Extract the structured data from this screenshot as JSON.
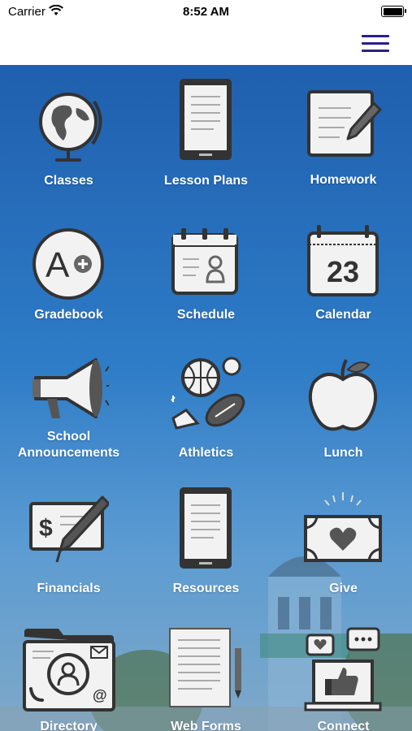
{
  "status_bar": {
    "carrier": "Carrier",
    "time": "8:52 AM"
  },
  "nav": {
    "menu_icon": "hamburger-menu-icon"
  },
  "tiles": [
    {
      "label": "Classes",
      "icon": "globe-icon"
    },
    {
      "label": "Lesson Plans",
      "icon": "tablet-icon"
    },
    {
      "label": "Homework",
      "icon": "notepad-pencil-icon"
    },
    {
      "label": "Gradebook",
      "icon": "grade-a-plus-icon"
    },
    {
      "label": "Schedule",
      "icon": "schedule-icon"
    },
    {
      "label": "Calendar",
      "icon": "calendar-icon",
      "number": "23"
    },
    {
      "label": "School Announcements",
      "icon": "megaphone-icon"
    },
    {
      "label": "Athletics",
      "icon": "sports-balls-icon"
    },
    {
      "label": "Lunch",
      "icon": "apple-icon"
    },
    {
      "label": "Financials",
      "icon": "check-pen-icon"
    },
    {
      "label": "Resources",
      "icon": "tablet-icon"
    },
    {
      "label": "Give",
      "icon": "donation-heart-icon"
    },
    {
      "label": "Directory",
      "icon": "directory-folder-icon"
    },
    {
      "label": "Web Forms",
      "icon": "document-pencil-icon"
    },
    {
      "label": "Connect",
      "icon": "social-laptop-icon"
    }
  ],
  "colors": {
    "background_top": "#1f5fae",
    "menu_icon": "#2c1f86",
    "icon_fill": "#f2f2f2",
    "icon_stroke": "#333333"
  }
}
